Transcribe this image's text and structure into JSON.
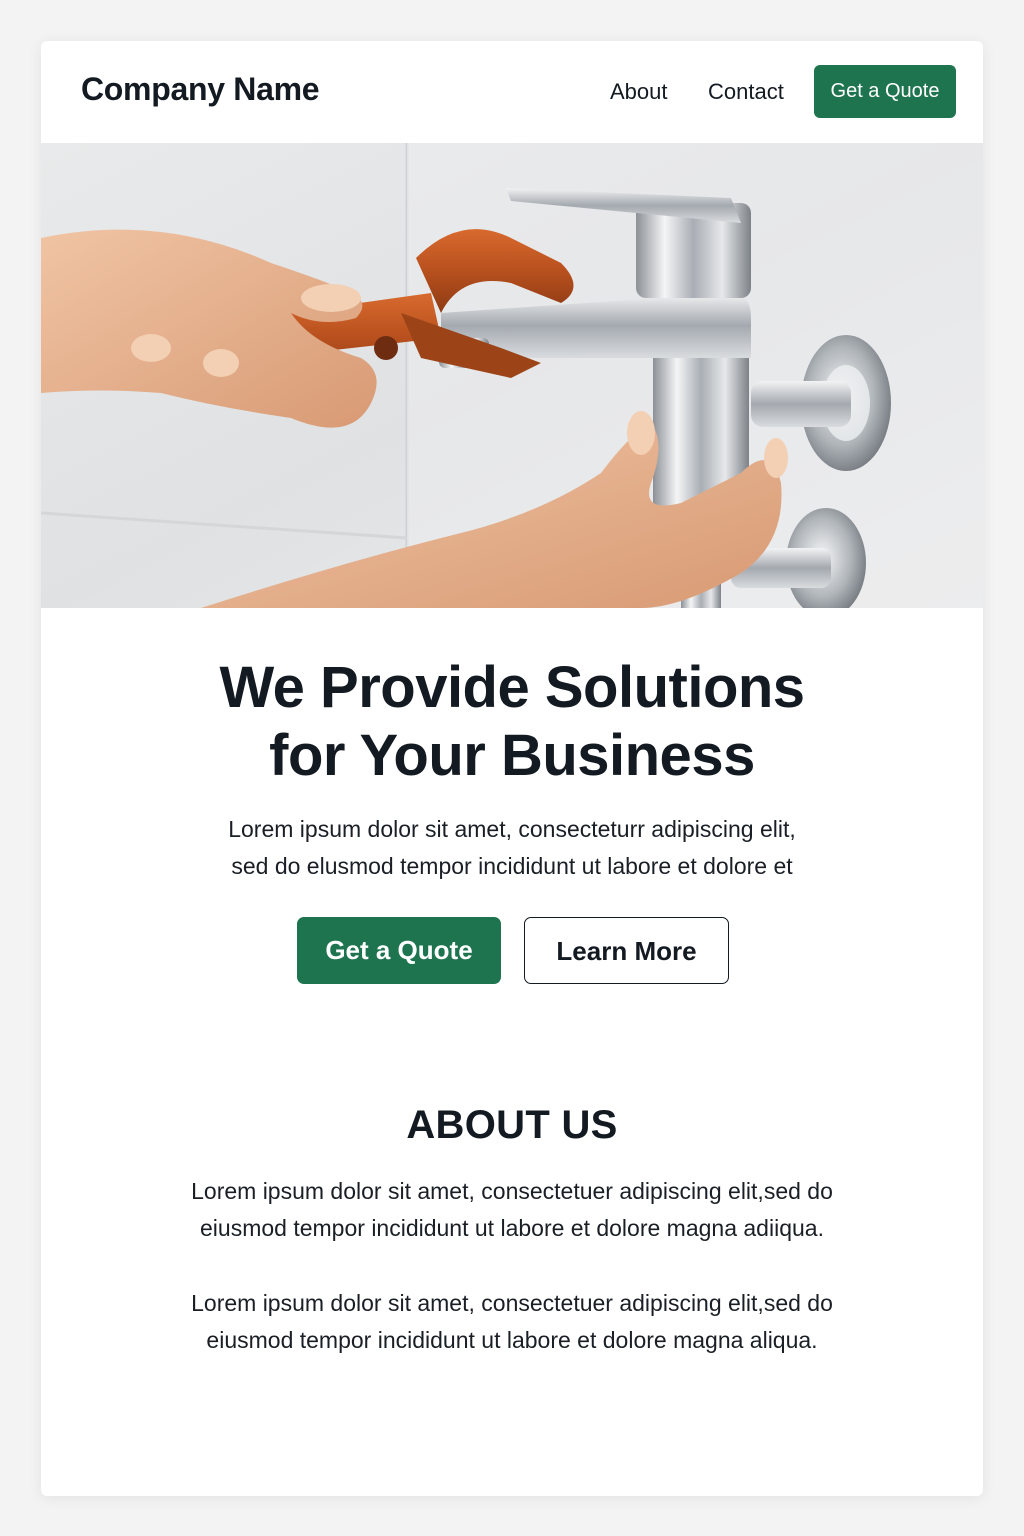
{
  "header": {
    "brand": "Company Name",
    "nav": {
      "about": "About",
      "contact": "Contact",
      "quote_button": "Get a Quote"
    }
  },
  "hero": {
    "image_alt": "Hands using an orange pipe wrench on a chrome faucet",
    "headline_line1": "We Provide Solutions",
    "headline_line2": "for Your Business",
    "subtext_line1": "Lorem ipsum dolor sit amet, consecteturr adipiscing elit,",
    "subtext_line2": "sed do elusmod tempor incididunt ut labore et dolore et",
    "primary_button": "Get a Quote",
    "secondary_button": "Learn More"
  },
  "about": {
    "title": "ABOUT US",
    "paragraph1_line1": "Lorem ipsum dolor sit amet, consectetuer adipiscing elit,sed do",
    "paragraph1_line2": "eiusmod tempor incididunt ut labore et dolore magna adiiqua.",
    "paragraph2_line1": "Lorem ipsum dolor sit amet, consectetuer adipiscing elit,sed do",
    "paragraph2_line2": "eiusmod tempor incididunt ut labore et dolore magna aliqua."
  },
  "colors": {
    "accent": "#1f7450",
    "text": "#141a22",
    "background": "#f3f3f3",
    "card": "#ffffff"
  }
}
